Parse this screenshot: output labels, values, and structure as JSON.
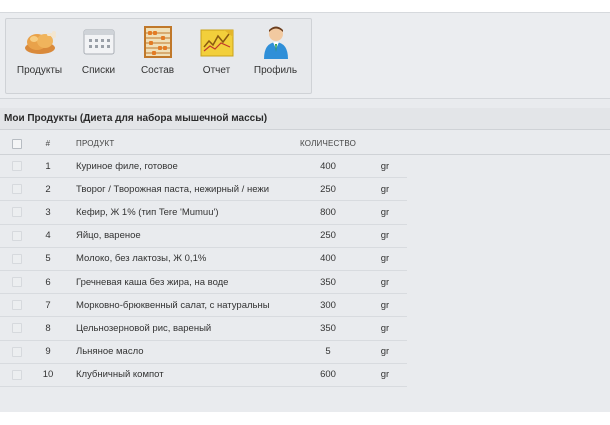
{
  "toolbar": {
    "items": [
      {
        "label": "Продукты",
        "icon": "chicken-icon"
      },
      {
        "label": "Списки",
        "icon": "grid-list-icon"
      },
      {
        "label": "Состав",
        "icon": "abacus-icon"
      },
      {
        "label": "Отчет",
        "icon": "chart-report-icon"
      },
      {
        "label": "Профиль",
        "icon": "user-profile-icon"
      }
    ]
  },
  "section": {
    "title": "Мои Продукты (Диета для набора мышечной массы)"
  },
  "table": {
    "headers": {
      "num": "#",
      "product": "ПРОДУКТ",
      "quantity": "КОЛИЧЕСТВО"
    },
    "rows": [
      {
        "num": "1",
        "product": "Куриное филе, готовое",
        "qty": "400",
        "unit": "gr"
      },
      {
        "num": "2",
        "product": "Творог / Творожная паста, нежирный / нежи",
        "qty": "250",
        "unit": "gr"
      },
      {
        "num": "3",
        "product": "Кефир, Ж 1% (тип Tere 'Mumuu')",
        "qty": "800",
        "unit": "gr"
      },
      {
        "num": "4",
        "product": "Яйцо, вареное",
        "qty": "250",
        "unit": "gr"
      },
      {
        "num": "5",
        "product": "Молоко, без лактозы, Ж 0,1%",
        "qty": "400",
        "unit": "gr"
      },
      {
        "num": "6",
        "product": "Гречневая каша без жира, на воде",
        "qty": "350",
        "unit": "gr"
      },
      {
        "num": "7",
        "product": "Морковно-брюквенный салат, с натуральны",
        "qty": "300",
        "unit": "gr"
      },
      {
        "num": "8",
        "product": "Цельнозерновой рис, вареный",
        "qty": "350",
        "unit": "gr"
      },
      {
        "num": "9",
        "product": "Льняное масло",
        "qty": "5",
        "unit": "gr"
      },
      {
        "num": "10",
        "product": "Клубничный компот",
        "qty": "600",
        "unit": "gr"
      }
    ]
  },
  "colors": {
    "background": "#e9ebee",
    "header_text": "#2a2a2a",
    "row_border": "#d8dbdf"
  }
}
